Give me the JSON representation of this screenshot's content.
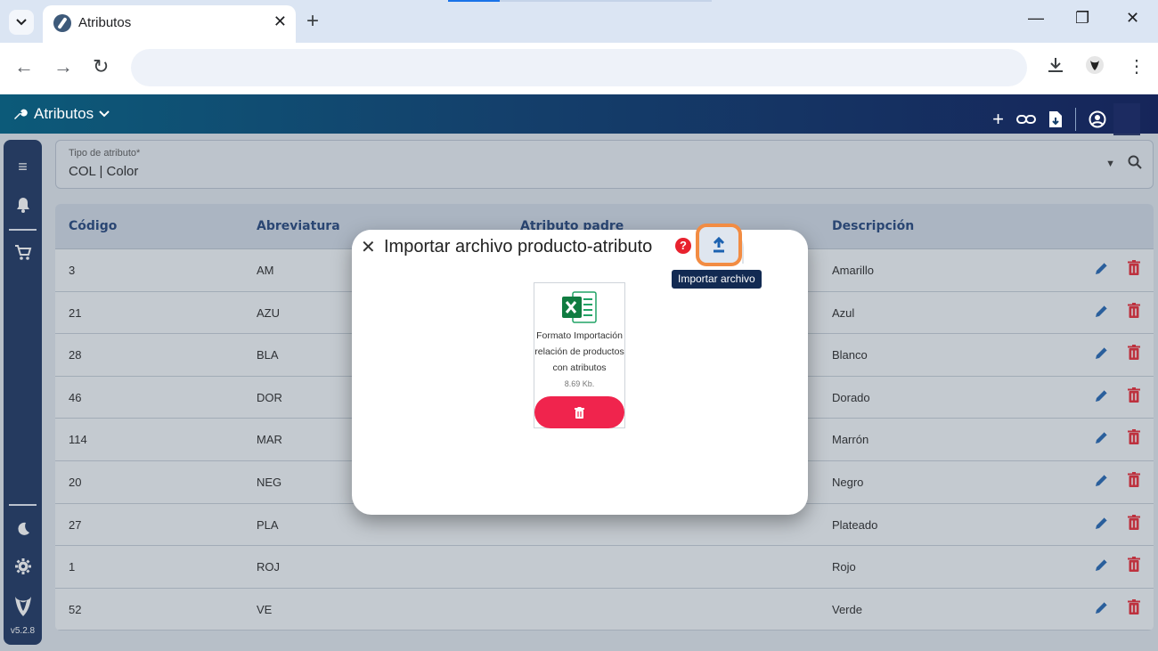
{
  "browser": {
    "tab_title": "Atributos",
    "new_tab": "+",
    "close_tab": "✕"
  },
  "app": {
    "title": "Atributos",
    "version": "v5.2.8"
  },
  "filter": {
    "label": "Tipo de atributo*",
    "value": "COL | Color"
  },
  "table": {
    "headers": [
      "Código",
      "Abreviatura",
      "Atributo padre",
      "Descripción"
    ],
    "rows": [
      {
        "codigo": "3",
        "abrev": "AM",
        "padre": "",
        "desc": "Amarillo"
      },
      {
        "codigo": "21",
        "abrev": "AZU",
        "padre": "",
        "desc": "Azul"
      },
      {
        "codigo": "28",
        "abrev": "BLA",
        "padre": "",
        "desc": "Blanco"
      },
      {
        "codigo": "46",
        "abrev": "DOR",
        "padre": "",
        "desc": "Dorado"
      },
      {
        "codigo": "114",
        "abrev": "MAR",
        "padre": "",
        "desc": "Marrón"
      },
      {
        "codigo": "20",
        "abrev": "NEG",
        "padre": "",
        "desc": "Negro"
      },
      {
        "codigo": "27",
        "abrev": "PLA",
        "padre": "",
        "desc": "Plateado"
      },
      {
        "codigo": "1",
        "abrev": "ROJ",
        "padre": "",
        "desc": "Rojo"
      },
      {
        "codigo": "52",
        "abrev": "VE",
        "padre": "",
        "desc": "Verde"
      }
    ]
  },
  "modal": {
    "title": "Importar archivo producto-atributo",
    "help": "?",
    "tooltip": "Importar archivo",
    "file": {
      "name": "Formato Importación relación de productos con atributos",
      "size": "8.69 Kb."
    }
  },
  "colors": {
    "accent": "#1c62b0",
    "danger": "#e8222e",
    "highlight": "#f28c43",
    "header_text": "#1c3f78"
  }
}
